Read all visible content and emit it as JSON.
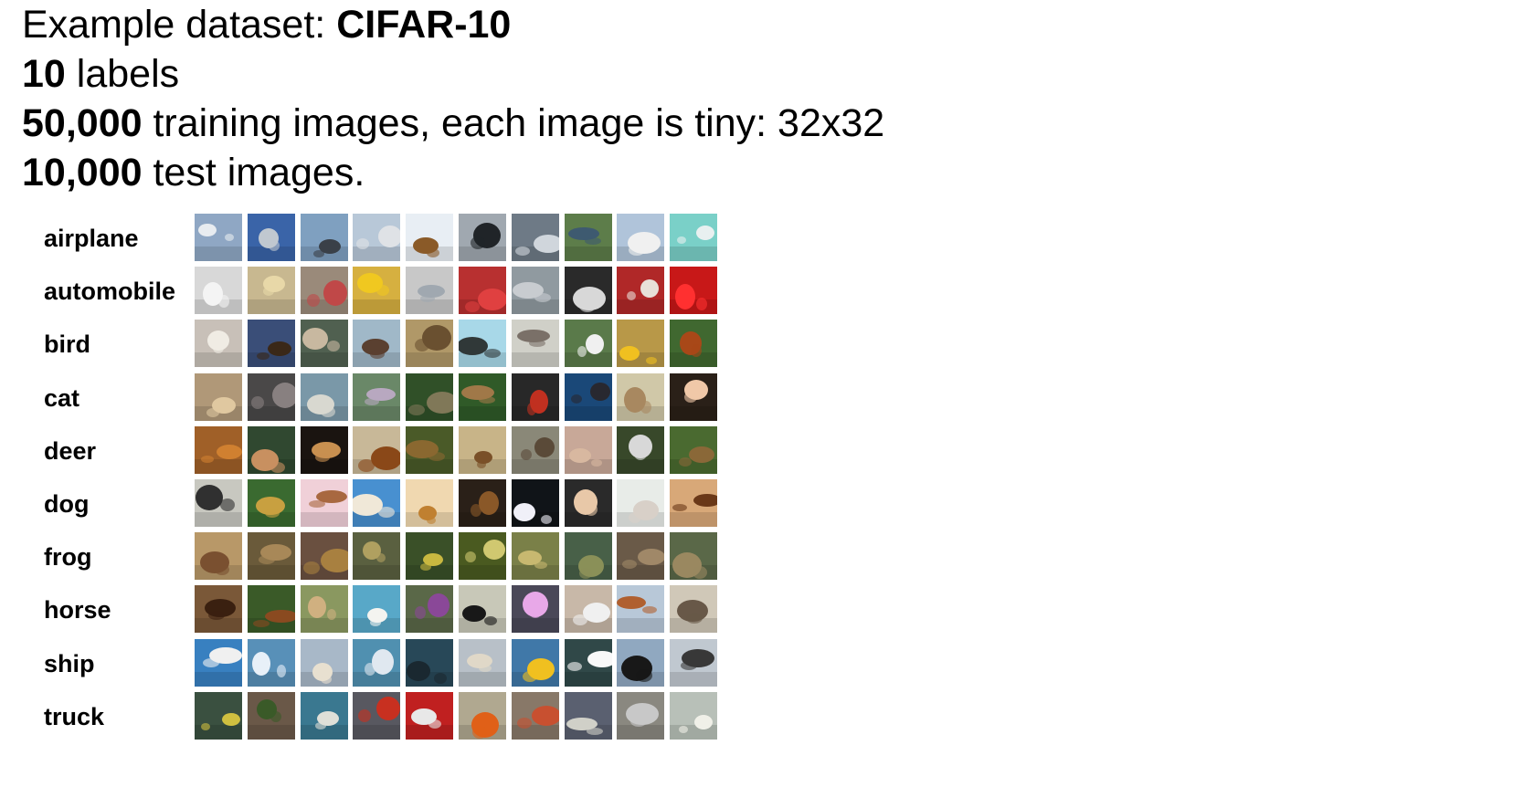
{
  "intro": {
    "line1_prefix": "Example dataset: ",
    "line1_bold": "CIFAR-10",
    "line2_bold": "10",
    "line2_rest": " labels",
    "line3_bold": "50,000",
    "line3_rest": " training images, each image is tiny: 32x32",
    "line4_bold": "10,000",
    "line4_rest": " test images."
  },
  "classes": [
    {
      "label": "airplane",
      "bg": [
        "#8fa7c4",
        "#3a64a8",
        "#7fa0c0",
        "#b8c8d8",
        "#e8eef4",
        "#a0a8b0",
        "#6e7a86",
        "#5d7d4a",
        "#b0c4da",
        "#7ad0c8"
      ],
      "fg": [
        "#e8ecf0",
        "#c0c8d0",
        "#3a4048",
        "#dfe2e6",
        "#8a5a28",
        "#202428",
        "#d0d6dc",
        "#3e5a70",
        "#f0f0f0",
        "#e8f0f0"
      ]
    },
    {
      "label": "automobile",
      "bg": [
        "#d8d8d8",
        "#c8b890",
        "#9a8a7a",
        "#d6b040",
        "#c8c8c8",
        "#b83030",
        "#909aa0",
        "#2a2a2a",
        "#b02828",
        "#c81818"
      ],
      "fg": [
        "#f4f4f4",
        "#e8d8a8",
        "#c04848",
        "#f0c820",
        "#a0a8b0",
        "#e04040",
        "#c8ccd0",
        "#d8d8d8",
        "#e8e0d8",
        "#ff3030"
      ]
    },
    {
      "label": "bird",
      "bg": [
        "#c8c0b8",
        "#3a4e78",
        "#506050",
        "#a0b8c8",
        "#b09868",
        "#a8d8e8",
        "#d0d0c8",
        "#5a7a4a",
        "#b89848",
        "#406830"
      ],
      "fg": [
        "#f0ece4",
        "#3a2818",
        "#c8b8a0",
        "#5a4030",
        "#6a5030",
        "#303838",
        "#7a7068",
        "#f0f0f0",
        "#f0c020",
        "#a84818"
      ]
    },
    {
      "label": "cat",
      "bg": [
        "#b09878",
        "#4a4848",
        "#7a98a8",
        "#6a8868",
        "#305028",
        "#305a28",
        "#282828",
        "#1a4878",
        "#d0c8a8",
        "#2a2018"
      ],
      "fg": [
        "#e0c8a0",
        "#888080",
        "#d8d8d0",
        "#b8a8c0",
        "#807858",
        "#a07848",
        "#c03020",
        "#282830",
        "#a88860",
        "#f0c8a8"
      ]
    },
    {
      "label": "deer",
      "bg": [
        "#a06028",
        "#304830",
        "#1a1410",
        "#c8b898",
        "#4a5a28",
        "#c8b488",
        "#8a8878",
        "#c8a898",
        "#38482a",
        "#4a6a30"
      ],
      "fg": [
        "#d08030",
        "#c89060",
        "#c89050",
        "#8a4818",
        "#8a6830",
        "#7a5028",
        "#5a4a38",
        "#d8b8a0",
        "#d8d8d8",
        "#8a6838"
      ]
    },
    {
      "label": "dog",
      "bg": [
        "#c8c8c0",
        "#3a6a30",
        "#f0d0d8",
        "#4890d0",
        "#f0d8b0",
        "#2a2018",
        "#101418",
        "#2a2a2a",
        "#e8ece8",
        "#d8a878"
      ],
      "fg": [
        "#303030",
        "#c8a040",
        "#a86840",
        "#f0e8d8",
        "#c08030",
        "#8a5828",
        "#f0f0f8",
        "#e8c8a8",
        "#d8d0c8",
        "#6a3818"
      ]
    },
    {
      "label": "frog",
      "bg": [
        "#b89868",
        "#6a5a3a",
        "#6a5040",
        "#5a6040",
        "#3a5028",
        "#4a5a20",
        "#7a8048",
        "#486048",
        "#6a5a48",
        "#5a6848"
      ],
      "fg": [
        "#7a5030",
        "#a88858",
        "#a88040",
        "#b0a060",
        "#c8b840",
        "#d0c870",
        "#c8b870",
        "#8a9058",
        "#a08868",
        "#9a8860"
      ]
    },
    {
      "label": "horse",
      "bg": [
        "#7a5838",
        "#3a5a28",
        "#8a9860",
        "#58a8c8",
        "#5a6848",
        "#c8c8b8",
        "#4a4858",
        "#c8b8a8",
        "#b8c8d8",
        "#d0c8b8"
      ],
      "fg": [
        "#3a2010",
        "#8a4a20",
        "#d0b080",
        "#f4f4f0",
        "#8a4898",
        "#181818",
        "#e8a8e8",
        "#f0f0f0",
        "#b06030",
        "#685848"
      ]
    },
    {
      "label": "ship",
      "bg": [
        "#3880c0",
        "#5890b8",
        "#a8b8c8",
        "#5090b0",
        "#284858",
        "#b8c0c8",
        "#4078a8",
        "#304848",
        "#90a8c0",
        "#c0c8d0"
      ],
      "fg": [
        "#f0f0f0",
        "#e8f0f8",
        "#e8e0d0",
        "#e0e8f0",
        "#1a2830",
        "#e0d8c8",
        "#f0c020",
        "#f8f8f8",
        "#181818",
        "#383838"
      ]
    },
    {
      "label": "truck",
      "bg": [
        "#3a5040",
        "#6a5848",
        "#3a7890",
        "#585860",
        "#c02020",
        "#b0a890",
        "#887868",
        "#5a6070",
        "#8a8880",
        "#b8c0b8"
      ],
      "fg": [
        "#d0c040",
        "#3a5a28",
        "#e0e0d8",
        "#c83020",
        "#e8e8e8",
        "#e06018",
        "#c85030",
        "#d0d0c8",
        "#c8c8c8",
        "#f0f0e8"
      ]
    }
  ]
}
